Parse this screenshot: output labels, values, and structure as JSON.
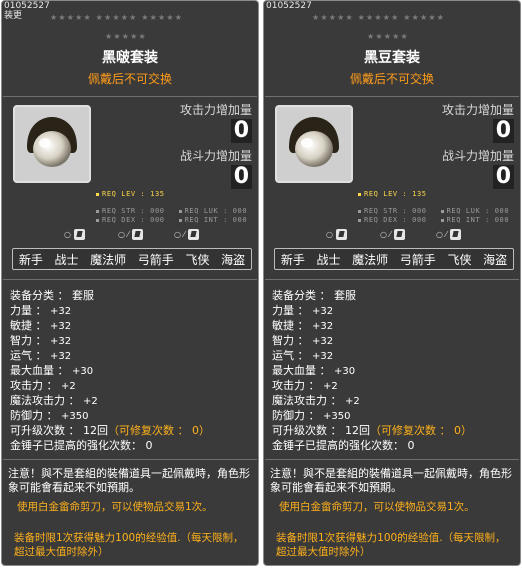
{
  "tooltips": [
    {
      "item_id": "01052527",
      "subtext": "装更",
      "stars_row1": "★★★★★ ★★★★★ ★★★★★",
      "stars_row2": "★★★★★",
      "name": "黑啵套装",
      "trade_note": "佩戴后不可交换",
      "atk_label": "攻击力增加量",
      "atk_value": "0",
      "power_label": "战斗力增加量",
      "power_value": "0",
      "req_lev": "REQ LEV : 135",
      "req_str": "REQ STR : 000",
      "req_luk": "REQ LUK : 000",
      "req_dex": "REQ DEX : 000",
      "req_int": "REQ INT : 000",
      "gender": [
        "○",
        "○ ⁄",
        "○ ⁄"
      ],
      "jobs": [
        "新手",
        "战士",
        "魔法师",
        "弓箭手",
        "飞侠",
        "海盗"
      ],
      "specs": {
        "category_label": "装备分类 ： ",
        "category": "套服",
        "str_label": "力量 ： ",
        "str": "+32",
        "dex_label": "敏捷 ： ",
        "dex": "+32",
        "int_label": "智力 ： ",
        "int": "+32",
        "luk_label": "运气 ： ",
        "luk": "+32",
        "hp_label": "最大血量 ： ",
        "hp": "+30",
        "atk_label": "攻击力 ： ",
        "atk": "+2",
        "matk_label": "魔法攻击力 ： ",
        "matk": "+2",
        "def_label": "防御力 ： ",
        "def": "+350",
        "upgrade_label": "可升级次数 ： ",
        "upgrade": "12回",
        "repair": "（可修复次数 ： 0）",
        "hammer_label": "金锤子已提高的强化次数： ",
        "hammer": "0"
      },
      "note1": "注意！與不是套組的裝備道具一起佩戴時，角色形象可能會看起来不如預期。",
      "note2": "使用白金畲命剪刀，可以使物品交易1次。",
      "note3": "装备时限1次获得魅力100的经验值.（每天限制，超过最大值时除外）"
    },
    {
      "item_id": "01052527",
      "subtext": "",
      "stars_row1": "★★★★★ ★★★★★ ★★★★★",
      "stars_row2": "★★★★★",
      "name": "黑豆套装",
      "trade_note": "佩戴后不可交换",
      "atk_label": "攻击力增加量",
      "atk_value": "0",
      "power_label": "战斗力增加量",
      "power_value": "0",
      "req_lev": "REQ LEV : 135",
      "req_str": "REQ STR : 000",
      "req_luk": "REQ LUK : 000",
      "req_dex": "REQ DEX : 000",
      "req_int": "REQ INT : 000",
      "gender": [
        "○",
        "○ ⁄",
        "○ ⁄"
      ],
      "jobs": [
        "新手",
        "战士",
        "魔法师",
        "弓箭手",
        "飞侠",
        "海盗"
      ],
      "specs": {
        "category_label": "装备分类 ： ",
        "category": "套服",
        "str_label": "力量 ： ",
        "str": "+32",
        "dex_label": "敏捷 ： ",
        "dex": "+32",
        "int_label": "智力 ： ",
        "int": "+32",
        "luk_label": "运气 ： ",
        "luk": "+32",
        "hp_label": "最大血量 ： ",
        "hp": "+30",
        "atk_label": "攻击力 ： ",
        "atk": "+2",
        "matk_label": "魔法攻击力 ： ",
        "matk": "+2",
        "def_label": "防御力 ： ",
        "def": "+350",
        "upgrade_label": "可升级次数 ： ",
        "upgrade": "12回",
        "repair": "（可修复次数 ： 0）",
        "hammer_label": "金锤子已提高的强化次数： ",
        "hammer": "0"
      },
      "note1": "注意！與不是套組的裝備道具一起佩戴時，角色形象可能會看起来不如預期。",
      "note2": "使用白金畲命剪刀，可以使物品交易1次。",
      "note3": "装备时限1次获得魅力100的经验值.（每天限制，超过最大值时除外）"
    }
  ],
  "colors": {
    "panel_bg": "#3a3a3a",
    "accent_orange": "#ff9c1a",
    "req_yellow": "#ffd84a"
  },
  "icons": [
    "egg-helmet-icon",
    "gender-icon"
  ]
}
